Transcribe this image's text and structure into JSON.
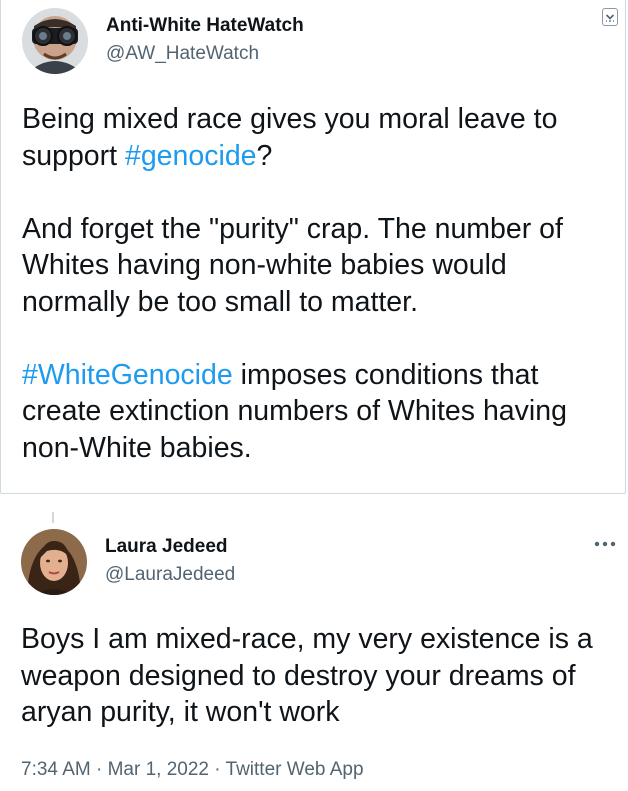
{
  "quoted_tweet": {
    "display_name": "Anti-White HateWatch",
    "handle": "@AW_HateWatch",
    "avatar_icon": "binoculars-man-avatar",
    "caret_icon": "chevron-down-icon",
    "paragraphs": [
      {
        "before": "Being mixed race gives you moral leave to support ",
        "hashtag": "#genocide",
        "after": "?"
      },
      {
        "before": "And forget the \"purity\" crap. The number of Whites having non-white babies would normally be too small to matter.",
        "hashtag": "",
        "after": ""
      },
      {
        "before": "",
        "hashtag": "#WhiteGenocide",
        "after": " imposes conditions that create extinction numbers of Whites having non-White babies."
      }
    ]
  },
  "main_tweet": {
    "display_name": "Laura Jedeed",
    "handle": "@LauraJedeed",
    "avatar_icon": "woman-portrait-avatar",
    "more_icon": "more-options-icon",
    "text": "Boys I am mixed-race, my very existence is a weapon designed to destroy your dreams of aryan purity, it won't work",
    "timestamp": "7:34 AM · Mar 1, 2022 · Twitter Web App"
  },
  "colors": {
    "hashtag": "#1d9bf0",
    "secondary_text": "#536471",
    "primary_text": "#0f1419",
    "border": "#cfd9de"
  }
}
